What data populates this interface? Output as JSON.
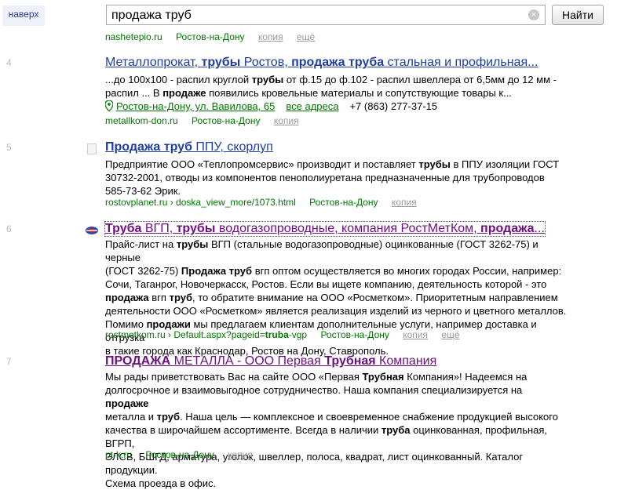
{
  "top": {
    "naverh": "наверх",
    "query": "продажа труб",
    "button": "Найти"
  },
  "partial": {
    "domain": "nashetepio.ru",
    "region": "Ростов-на-Дону",
    "copy": "копия",
    "more": "ещё"
  },
  "r4": {
    "num": "4",
    "title": [
      {
        "t": "Металлопрокат, ",
        "b": false
      },
      {
        "t": "трубы",
        "b": true
      },
      {
        "t": " Ростов, ",
        "b": false
      },
      {
        "t": "продажа труба",
        "b": true
      },
      {
        "t": " стальная и профильная...",
        "b": false
      }
    ],
    "snippet": [
      [
        {
          "t": "...до 100x100 - распил круглой ",
          "b": false
        },
        {
          "t": "трубы",
          "b": true
        },
        {
          "t": " от ф.15 до ф.102 - распил швеллера от 6,5мм до 12 мм -",
          "b": false
        }
      ],
      [
        {
          "t": "распил ... В ",
          "b": false
        },
        {
          "t": "продаже",
          "b": true
        },
        {
          "t": " появились кровельные материалы и сопутствующие товары к...",
          "b": false
        }
      ]
    ],
    "address": "Ростов-на-Дону, ул. Вавилова, 65",
    "all_addresses": "все адреса",
    "phone": "+7 (863) 277-37-15",
    "domain": "metallkom-don.ru",
    "region": "Ростов-на-Дону",
    "copy": "копия"
  },
  "r5": {
    "num": "5",
    "title": [
      {
        "t": "Продажа труб",
        "b": true
      },
      {
        "t": " ППУ, скорлуп",
        "b": false
      }
    ],
    "snippet": [
      [
        {
          "t": "Предприятие ООО «Теплопромсервис» производит и поставляет ",
          "b": false
        },
        {
          "t": "трубы",
          "b": true
        },
        {
          "t": " в ППУ изоляции ГОСТ",
          "b": false
        }
      ],
      [
        {
          "t": "30732-2001, отводы из компонентов пенополиуретана предназначенные для трубопроводов",
          "b": false
        }
      ],
      [
        {
          "t": "585-73-62 Эрик.",
          "b": false
        }
      ]
    ],
    "path": "rostovplanet.ru › doska_view_more/1073.html",
    "region": "Ростов-на-Дону",
    "copy": "копия"
  },
  "r6": {
    "num": "6",
    "title": [
      {
        "t": "Труба",
        "b": true
      },
      {
        "t": " ВГП, ",
        "b": false
      },
      {
        "t": "трубы",
        "b": true
      },
      {
        "t": " водогазопроводные, компания РостМетКом, ",
        "b": false
      },
      {
        "t": "продажа",
        "b": true
      },
      {
        "t": "...",
        "b": false
      }
    ],
    "snippet": [
      [
        {
          "t": "Прайс-лист на ",
          "b": false
        },
        {
          "t": "трубы",
          "b": true
        },
        {
          "t": " ВГП (стальные водогазопроводные) оцинкованные (ГОСТ 3262-75) и черные",
          "b": false
        }
      ],
      [
        {
          "t": "(ГОСТ 3262-75) ",
          "b": false
        },
        {
          "t": "Продажа труб",
          "b": true
        },
        {
          "t": " вгп оптом осуществляется во многих городах России, например:",
          "b": false
        }
      ],
      [
        {
          "t": "Сочи, Таганрог, Новочеркасск, Ростов. Если вы ищете компанию, деятельность которой - это",
          "b": false
        }
      ],
      [
        {
          "t": "продажа",
          "b": true
        },
        {
          "t": " вгп ",
          "b": false
        },
        {
          "t": "труб",
          "b": true
        },
        {
          "t": ", то обратите внимание на ООО «Росметком». Приоритетным направлением",
          "b": false
        }
      ],
      [
        {
          "t": "деятельности ООО «Росметком» является реализация изделий из черного и цветного металлов.",
          "b": false
        }
      ],
      [
        {
          "t": "Помимо ",
          "b": false
        },
        {
          "t": "продажи",
          "b": true
        },
        {
          "t": " мы предлагаем клиентам дополнительные услуги, например доставка и отгрузка",
          "b": false
        }
      ],
      [
        {
          "t": "в такие города как Краснодар, Ростов на Дону, Ставрополь.",
          "b": false
        }
      ]
    ],
    "path_pre": "rostmetkom.ru › Default.aspx?pageid=",
    "path_bold": "truba",
    "path_post": "-vgp",
    "region": "Ростов-на-Дону",
    "copy": "копия",
    "more": "ещё"
  },
  "r7": {
    "num": "7",
    "title": [
      {
        "t": "ПРОДАЖА",
        "b": true
      },
      {
        "t": " МЕТАЛЛА - ООО Первая ",
        "b": false
      },
      {
        "t": "Трубная",
        "b": true
      },
      {
        "t": " Компания",
        "b": false
      }
    ],
    "snippet": [
      [
        {
          "t": "Мы рады приветствовать Вас на сайте ООО «Первая ",
          "b": false
        },
        {
          "t": "Трубная",
          "b": true
        },
        {
          "t": " Компания»! Надеемся на",
          "b": false
        }
      ],
      [
        {
          "t": "долгосрочное и взаимовыгодное сотрудничество. Наша компания специализируется на ",
          "b": false
        },
        {
          "t": "продаже",
          "b": true
        }
      ],
      [
        {
          "t": "металла и ",
          "b": false
        },
        {
          "t": "труб",
          "b": true
        },
        {
          "t": ". Наша цель — комплексное и своевременное снабжение продукцией высокого",
          "b": false
        }
      ],
      [
        {
          "t": "качества в широчайшем ассортименте. Всегда в наличии ",
          "b": false
        },
        {
          "t": "труба",
          "b": true
        },
        {
          "t": " оцинкованная, профильная, ВГРП,",
          "b": false
        }
      ],
      [
        {
          "t": "ЭЛСВ, БШГД, арматура, уголок, швеллер, полоса, квадрат, лист оцинкованный. Каталог продукции.",
          "b": false
        }
      ],
      [
        {
          "t": "Схема проезда в офис.",
          "b": false
        }
      ]
    ],
    "domain": "pt-k.ru",
    "region": "Ростов-на-Дону",
    "copy": "копия"
  }
}
